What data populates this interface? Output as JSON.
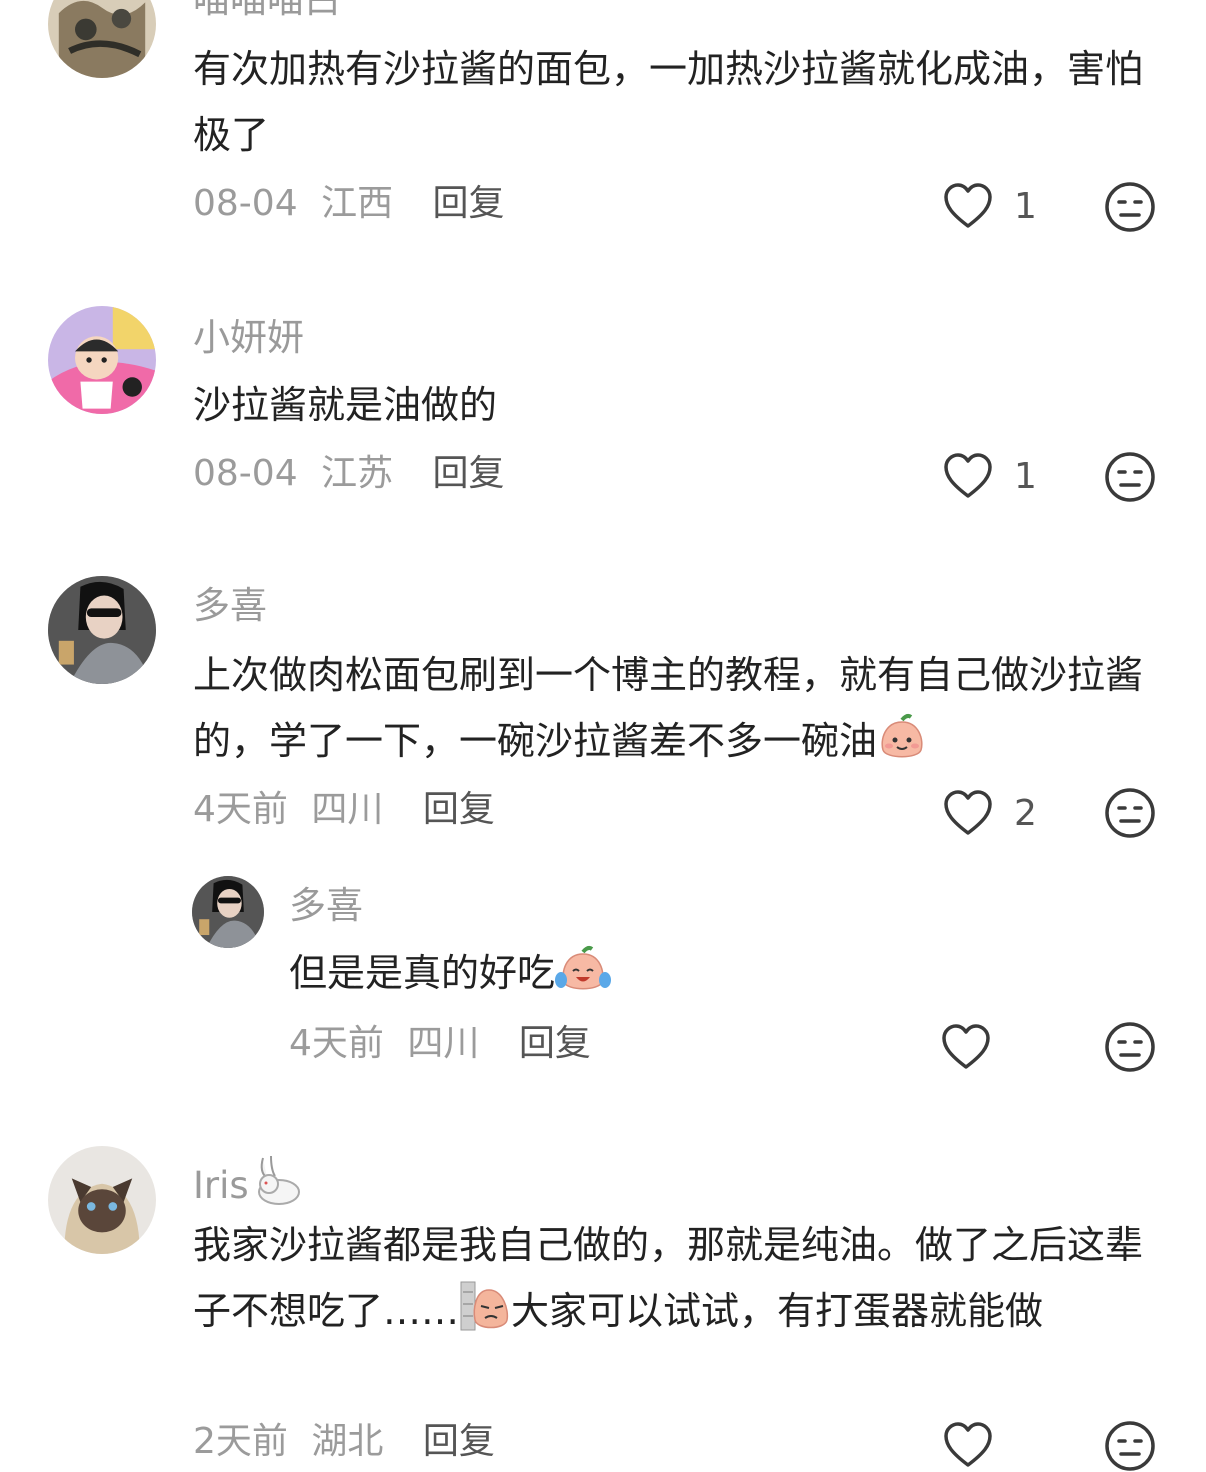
{
  "comments": [
    {
      "name": "喵喵喵白",
      "text": "有次加热有沙拉酱的面包，一加热沙拉酱就化成油，害怕极了",
      "date": "08-04",
      "location": "江西",
      "reply_label": "回复",
      "likes": "1"
    },
    {
      "name": "小妍妍",
      "text": "沙拉酱就是油做的",
      "date": "08-04",
      "location": "江苏",
      "reply_label": "回复",
      "likes": "1"
    },
    {
      "name": "多喜",
      "text": "上次做肉松面包刷到一个博主的教程，就有自己做沙拉酱的，学了一下，一碗沙拉酱差不多一碗油",
      "emoji": "peach-smile-emoji",
      "date": "4天前",
      "location": "四川",
      "reply_label": "回复",
      "likes": "2",
      "replies": [
        {
          "name": "多喜",
          "text": "但是是真的好吃",
          "emoji": "peach-cry-laugh-emoji",
          "date": "4天前",
          "location": "四川",
          "reply_label": "回复",
          "likes": ""
        }
      ]
    },
    {
      "name": "Iris",
      "name_emoji": "rabbit-emoji",
      "text_part1": "我家沙拉酱都是我自己做的，那就是纯油。做了之后这辈子不想吃了……",
      "text_emoji": "peach-wall-peek-emoji",
      "text_part2": "大家可以试试，有打蛋器就能做",
      "date": "2天前",
      "location": "湖北",
      "reply_label": "回复"
    }
  ],
  "icons": {
    "like": "heart-outline-icon",
    "reaction": "neutral-face-icon"
  },
  "colors": {
    "meta": "#9b9b9b",
    "name": "#9a9a9a",
    "text": "#222222",
    "icon": "#3a3a3a"
  }
}
